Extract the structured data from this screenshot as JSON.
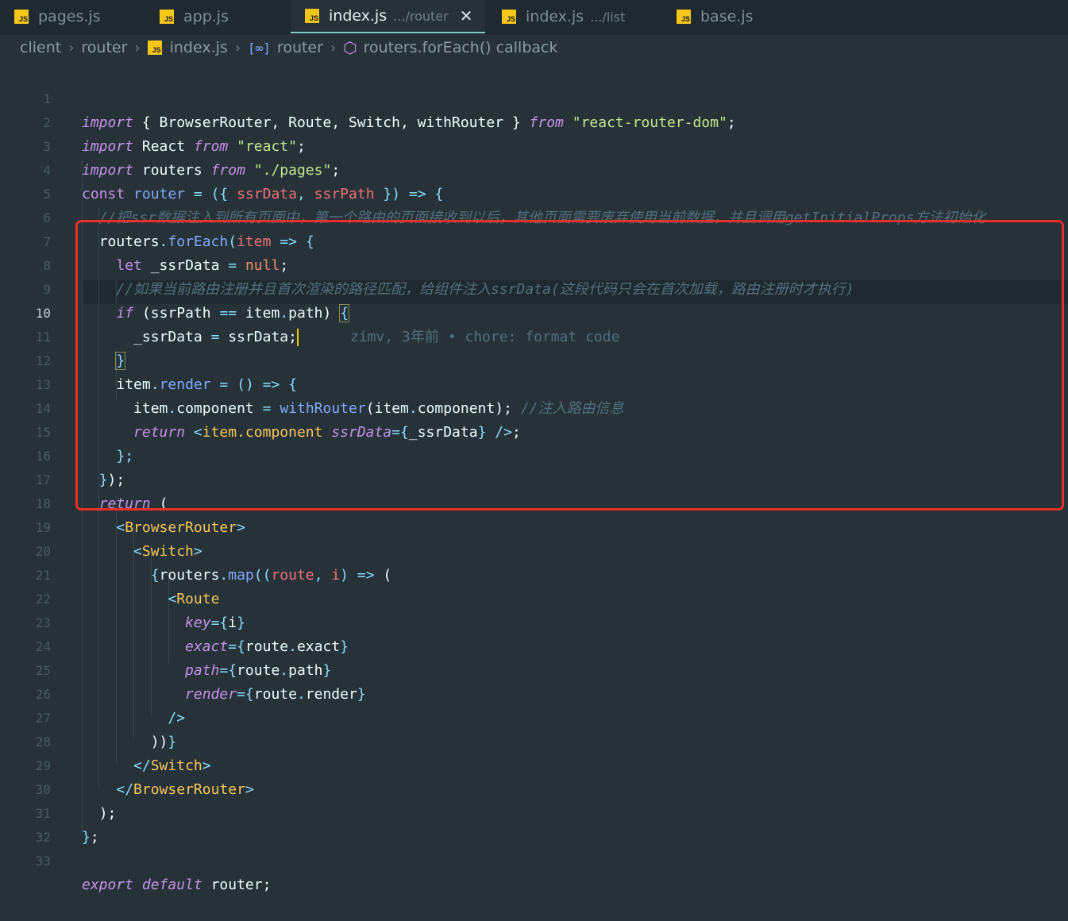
{
  "tabs": [
    {
      "name": "pages.js",
      "sub": ""
    },
    {
      "name": "app.js",
      "sub": ""
    },
    {
      "name": "index.js",
      "sub": ".../router",
      "active": true
    },
    {
      "name": "index.js",
      "sub": ".../list"
    },
    {
      "name": "base.js",
      "sub": ""
    }
  ],
  "tab_close_glyph": "✕",
  "file_icon_label": "JS",
  "breadcrumb": {
    "items": [
      "client",
      "router",
      "index.js",
      "router",
      "routers.forEach() callback"
    ]
  },
  "editor": {
    "current_line": 10,
    "blame": "zimv, 3年前 • chore: format code",
    "line_numbers": [
      "1",
      "2",
      "3",
      "4",
      "5",
      "6",
      "7",
      "8",
      "9",
      "10",
      "11",
      "12",
      "13",
      "14",
      "15",
      "16",
      "17",
      "18",
      "19",
      "20",
      "21",
      "22",
      "23",
      "24",
      "25",
      "26",
      "27",
      "28",
      "29",
      "30",
      "31",
      "32",
      "33"
    ],
    "tokens": {
      "import": "import",
      "from": "from",
      "const": "const",
      "let": "let",
      "if": "if",
      "return": "return",
      "export": "export",
      "default": "default",
      "null": "null",
      "l1_names": "{ BrowserRouter, Route, Switch, withRouter }",
      "l1_src": "\"react-router-dom\"",
      "l2_name": "React",
      "l2_src": "\"react\"",
      "l3_name": "routers",
      "l3_src": "\"./pages\"",
      "router": "router",
      "ssrData": "ssrData",
      "ssrPath": "ssrPath",
      "comment5": "//把ssr数据注入到所有页面中，第一个路由的页面接收到以后，其他页面需要废弃使用当前数据，并且调用getInitialProps方法初始化",
      "routers": "routers",
      "forEach": "forEach",
      "item": "item",
      "_ssrData": "_ssrData",
      "comment8": "//如果当前路由注册并且首次渲染的路径匹配，给组件注入ssrData(这段代码只会在首次加载，路由注册时才执行)",
      "path": "path",
      "render": "render",
      "component": "component",
      "withRouter": "withRouter",
      "comment13": "//注入路由信息",
      "jsx_item_component": "item.component",
      "attr_ssrData": "ssrData",
      "BrowserRouter": "BrowserRouter",
      "Switch": "Switch",
      "map": "map",
      "route": "route",
      "i": "i",
      "Route": "Route",
      "key": "key",
      "exact": "exact"
    }
  }
}
